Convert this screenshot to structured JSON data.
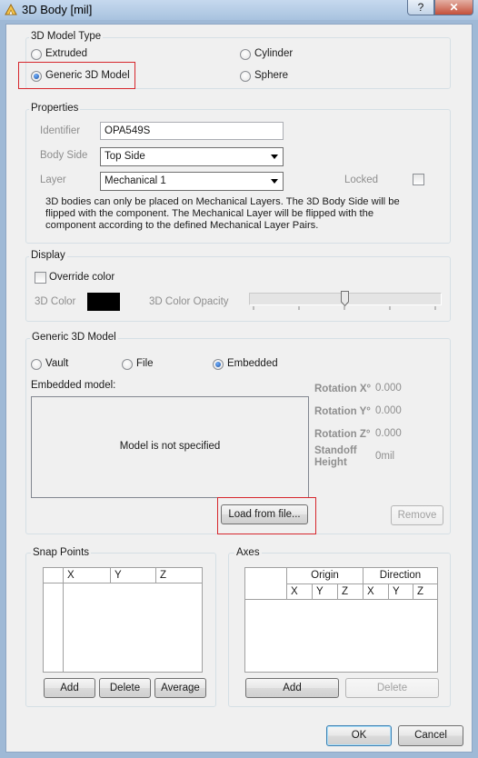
{
  "window": {
    "title": "3D Body [mil]",
    "help": "?",
    "close": "✕"
  },
  "model_type": {
    "legend": "3D Model Type",
    "options": [
      "Extruded",
      "Cylinder",
      "Generic 3D Model",
      "Sphere"
    ],
    "selected": "Generic 3D Model"
  },
  "properties": {
    "legend": "Properties",
    "identifier_label": "Identifier",
    "identifier_value": "OPA549S",
    "body_side_label": "Body Side",
    "body_side_value": "Top Side",
    "layer_label": "Layer",
    "layer_value": "Mechanical 1",
    "locked_label": "Locked",
    "locked": false,
    "info": "3D bodies can only be placed on Mechanical Layers. The 3D Body Side will be flipped with the component. The Mechanical Layer will be flipped with the component according to the defined Mechanical Layer Pairs."
  },
  "display": {
    "legend": "Display",
    "override_label": "Override color",
    "override": false,
    "color_label": "3D Color",
    "color_value": "#000000",
    "opacity_label": "3D Color Opacity",
    "opacity_fraction": 0.5
  },
  "generic": {
    "legend": "Generic 3D Model",
    "source_options": [
      "Vault",
      "File",
      "Embedded"
    ],
    "source_selected": "Embedded",
    "embedded_label": "Embedded model:",
    "placeholder": "Model is not specified",
    "rot_x_label": "Rotation X°",
    "rot_x": "0.000",
    "rot_y_label": "Rotation Y°",
    "rot_y": "0.000",
    "rot_z_label": "Rotation Z°",
    "rot_z": "0.000",
    "standoff_label": "Standoff Height",
    "standoff": "0mil",
    "load_button": "Load from file...",
    "remove_button": "Remove"
  },
  "snap_points": {
    "legend": "Snap Points",
    "columns": [
      "X",
      "Y",
      "Z"
    ],
    "add": "Add",
    "delete": "Delete",
    "average": "Average"
  },
  "axes": {
    "legend": "Axes",
    "group_headers": [
      "Origin",
      "Direction"
    ],
    "columns": [
      "X",
      "Y",
      "Z",
      "X",
      "Y",
      "Z"
    ],
    "add": "Add",
    "delete": "Delete"
  },
  "footer": {
    "ok": "OK",
    "cancel": "Cancel"
  }
}
